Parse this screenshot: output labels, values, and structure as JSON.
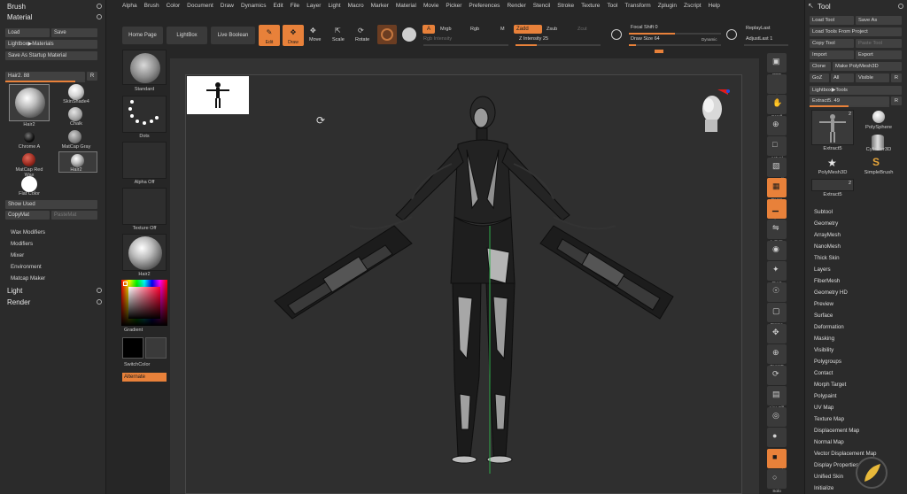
{
  "menu": [
    "Alpha",
    "Brush",
    "Color",
    "Document",
    "Draw",
    "Dynamics",
    "Edit",
    "File",
    "Layer",
    "Light",
    "Macro",
    "Marker",
    "Material",
    "Movie",
    "Picker",
    "Preferences",
    "Render",
    "Stencil",
    "Stroke",
    "Texture",
    "Tool",
    "Transform",
    "Zplugin",
    "Zscript",
    "Help"
  ],
  "left": {
    "brush_title": "Brush",
    "material_title": "Material",
    "load": "Load",
    "save": "Save",
    "lightbox_materials": "Lightbox▶Materials",
    "save_startup": "Save As Startup Material",
    "hair_slider": "Hair2. 88",
    "hair_slider_value": 0.88,
    "r": "R",
    "materials": [
      {
        "label": "Hair2",
        "color": "#d8d8d8"
      },
      {
        "label": "SkinShade4",
        "color": "#e6e6e6"
      },
      {
        "label": "Chalk",
        "color": "#bbbbbb"
      },
      {
        "label": "Chrome A",
        "color": "#111111"
      },
      {
        "label": "MatCap Gray",
        "color": "#8a8a8a"
      },
      {
        "label": "MatCap Red Wax",
        "color": "#a0281e"
      },
      {
        "label": "Hair2",
        "color": "#cfcfcf"
      },
      {
        "label": "Flat Color",
        "color": "#ffffff"
      }
    ],
    "show_used": "Show Used",
    "copy_mat": "CopyMat",
    "paste_mat": "PasteMat",
    "submenu": [
      "Wax Modifiers",
      "Modifiers",
      "Mixer",
      "Environment",
      "Matcap Maker"
    ],
    "light_title": "Light",
    "render_title": "Render"
  },
  "shelf": {
    "home_page": "Home Page",
    "lightbox": "LightBox",
    "live_boolean": "Live Boolean",
    "standard": "Standard",
    "dots": "Dots",
    "alpha_off": "Alpha Off",
    "texture_off": "Texture Off",
    "hair2": "Hair2",
    "gradient": "Gradient",
    "switch_color": "SwitchColor",
    "alternate": "Alternate"
  },
  "top": {
    "edit": "Edit",
    "draw": "Draw",
    "move": "Move",
    "scale": "Scale",
    "rotate": "Rotate",
    "a": "A",
    "mrgb": "Mrgb",
    "rgb": "Rgb",
    "m": "M",
    "zadd": "Zadd",
    "zsub": "Zsub",
    "zcut": "Zcut",
    "rgb_intensity": "Rgb Intensity",
    "z_intensity": "Z Intensity 25",
    "z_intensity_value": 0.25,
    "focal_shift": "Focal Shift 0",
    "draw_size": "Draw Size 64",
    "draw_size_value": 0.08,
    "dynamic": "Dynamic",
    "replay_last": "ReplayLast",
    "adjust_last": "AdjustLast 1"
  },
  "right_shelf": [
    "BPR",
    "SPix 3",
    "Scroll",
    "Zoom",
    "Actual",
    "AAHalf",
    "Persp",
    "Floor",
    "L.Sym",
    "",
    "Qxyz",
    "",
    "Frame",
    "Move",
    "ZoomD",
    "Rotate",
    "Line Fill PolyF",
    "Transp",
    "",
    "Dynamic",
    "Solo"
  ],
  "right": {
    "tool_title": "Tool",
    "load_tool": "Load Tool",
    "save_as": "Save As",
    "load_from_project": "Load Tools From Project",
    "copy_tool": "Copy Tool",
    "paste_tool": "Paste Tool",
    "import": "Import",
    "export": "Export",
    "clone": "Clone",
    "make_polymesh": "Make PolyMesh3D",
    "goz": "GoZ",
    "all": "All",
    "visible": "Visible",
    "r": "R",
    "lightbox_tools": "Lightbox▶Tools",
    "extract_slider": "Extract5. 49",
    "extract_slider_value": 0.49,
    "tools": [
      {
        "label": "Extract5",
        "badge": "2"
      },
      {
        "label": "PolySphere",
        "badge": ""
      },
      {
        "label": "PolyMesh3D",
        "badge": ""
      },
      {
        "label": "Cylinder3D",
        "badge": ""
      },
      {
        "label": "SimpleBrush",
        "badge": ""
      },
      {
        "label": "Extract5",
        "badge": "2"
      }
    ],
    "submenus": [
      "Subtool",
      "Geometry",
      "ArrayMesh",
      "NanoMesh",
      "Thick Skin",
      "Layers",
      "FiberMesh",
      "Geometry HD",
      "Preview",
      "Surface",
      "Deformation",
      "Masking",
      "Visibility",
      "Polygroups",
      "Contact",
      "Morph Target",
      "Polypaint",
      "UV Map",
      "Texture Map",
      "Displacement Map",
      "Normal Map",
      "Vector Displacement Map",
      "Display Properties",
      "Unified Skin",
      "Initialize"
    ]
  }
}
